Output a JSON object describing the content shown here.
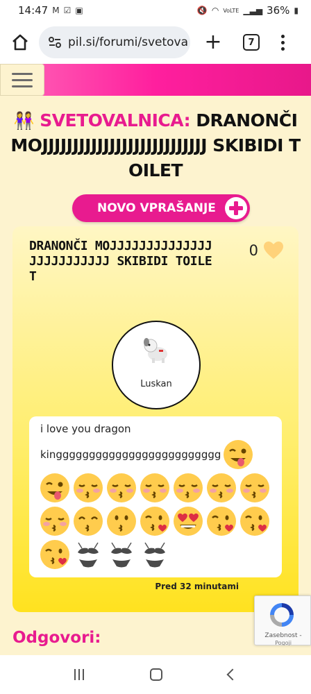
{
  "status_bar": {
    "time": "14:47",
    "battery": "36%",
    "network": "VoLTE"
  },
  "browser": {
    "url": "pil.si/forumi/svetova",
    "tab_count": "7"
  },
  "page": {
    "category": "SVETOVALNICA:",
    "title_rest": " DRANONČI MOJJJJJJJJJJJJJJJJJJJJJJJJJJJ SKIBIDI TOILET",
    "title_emoji": "👭",
    "new_question_label": "NOVO VPRAŠANJE",
    "answers_heading": "Odgovori:"
  },
  "question": {
    "title": "DRANONČI MOJJJJJJJJJJJJJJJJJJJJJJJJJ SKIBIDI TOILET",
    "likes": "0",
    "author": "Luskan",
    "body_line1": "i love you dragon",
    "body_line2": "kinggggggggggggggggggggggggg",
    "timestamp": "Pred 32 minutami",
    "emoji_rows": [
      [
        "winking-tongue"
      ],
      [
        "winking-tongue",
        "kissing-blush",
        "kissing-blush",
        "kissing-blush",
        "kissing-blush",
        "kissing-blush",
        "kissing-blush"
      ],
      [
        "kissing-blush",
        "kissing-smiling-eyes",
        "kissing",
        "kissing-heart",
        "heart-eyes",
        "kissing-heart",
        "kissing-heart"
      ],
      [
        "kissing-heart",
        "bikini",
        "bikini",
        "bikini"
      ]
    ]
  },
  "recaptcha": {
    "label": "Zasebnost -",
    "label2": "Pogoji"
  },
  "colors": {
    "brand_pink": "#e81b8f",
    "background": "#fdf3cf",
    "card_yellow": "#ffe21f"
  }
}
